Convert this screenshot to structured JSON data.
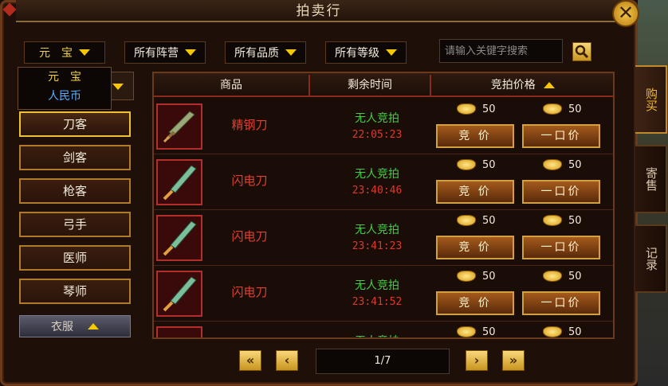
{
  "window": {
    "title": "拍卖行"
  },
  "filters": {
    "currency": "元　宝",
    "faction": "所有阵营",
    "quality": "所有品质",
    "level": "所有等级",
    "search_placeholder": "请输入关键字搜索"
  },
  "currency_popup": [
    "元　宝",
    "人民币"
  ],
  "categories": [
    "刀客",
    "剑客",
    "枪客",
    "弓手",
    "医师",
    "琴师"
  ],
  "category_fold": "衣服",
  "table": {
    "headers": [
      "商品",
      "剩余时间",
      "竞拍价格"
    ],
    "rows": [
      {
        "name": "精钢刀",
        "state": "无人竞拍",
        "time": "22:05:23",
        "bid_price": "50",
        "buyout_price": "50"
      },
      {
        "name": "闪电刀",
        "state": "无人竞拍",
        "time": "23:40:46",
        "bid_price": "50",
        "buyout_price": "50"
      },
      {
        "name": "闪电刀",
        "state": "无人竞拍",
        "time": "23:41:23",
        "bid_price": "50",
        "buyout_price": "50"
      },
      {
        "name": "闪电刀",
        "state": "无人竞拍",
        "time": "23:41:52",
        "bid_price": "50",
        "buyout_price": "50"
      },
      {
        "name": "",
        "state": "无人竞拍",
        "time": "",
        "bid_price": "50",
        "buyout_price": "50"
      }
    ],
    "bid_label": "竞 价",
    "buyout_label": "一口价"
  },
  "pager": {
    "page": "1/7"
  },
  "side_tabs": [
    "购买",
    "寄售",
    "记录"
  ],
  "colors": {
    "gold": "#f6c800",
    "item_red": "#e04030",
    "state_green": "#40d040"
  },
  "icons": {
    "close": "close-icon",
    "search": "search-icon",
    "currency": "gold-ingot-icon"
  }
}
